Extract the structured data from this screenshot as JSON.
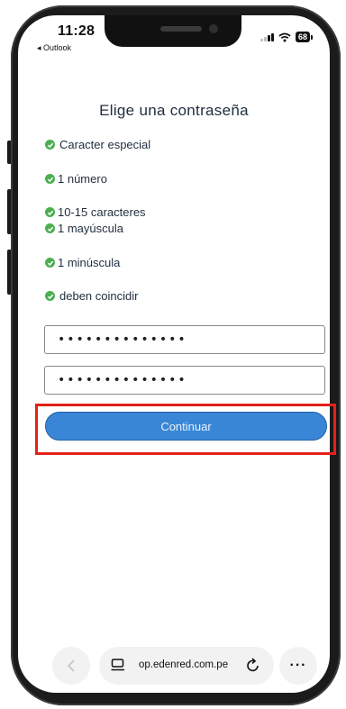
{
  "status_bar": {
    "time": "11:28",
    "back_app": "◂ Outlook",
    "battery": "68"
  },
  "page": {
    "title": "Elige una contraseña",
    "rules": [
      {
        "label": "Caracter especial"
      },
      {
        "label": "1 número"
      },
      {
        "label": "10-15 caracteres"
      },
      {
        "label": "1 mayúscula"
      },
      {
        "label": "1 minúscula"
      },
      {
        "label": "deben coincidir"
      }
    ],
    "password_value": "••••••••••••••",
    "confirm_value": "••••••••••••••",
    "continue_label": "Continuar"
  },
  "browser": {
    "url": "op.edenred.com.pe",
    "more_label": "···"
  },
  "colors": {
    "check": "#4caf50",
    "button": "#3a86d6",
    "highlight": "#e3211b"
  }
}
